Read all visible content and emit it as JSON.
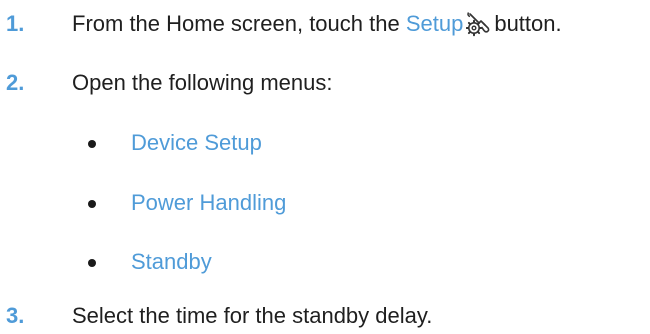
{
  "steps": [
    {
      "number": "1.",
      "text_before": "From the Home screen, touch the ",
      "link": "Setup",
      "icon": "setup-wrench-gear-icon",
      "text_after": "button."
    },
    {
      "number": "2.",
      "text": "Open the following menus:"
    },
    {
      "number": "3.",
      "text": "Select the time for the standby delay."
    }
  ],
  "menus": [
    "Device Setup",
    "Power Handling",
    "Standby"
  ],
  "colors": {
    "accent": "#4f9bd8",
    "text": "#1f1f1f"
  }
}
